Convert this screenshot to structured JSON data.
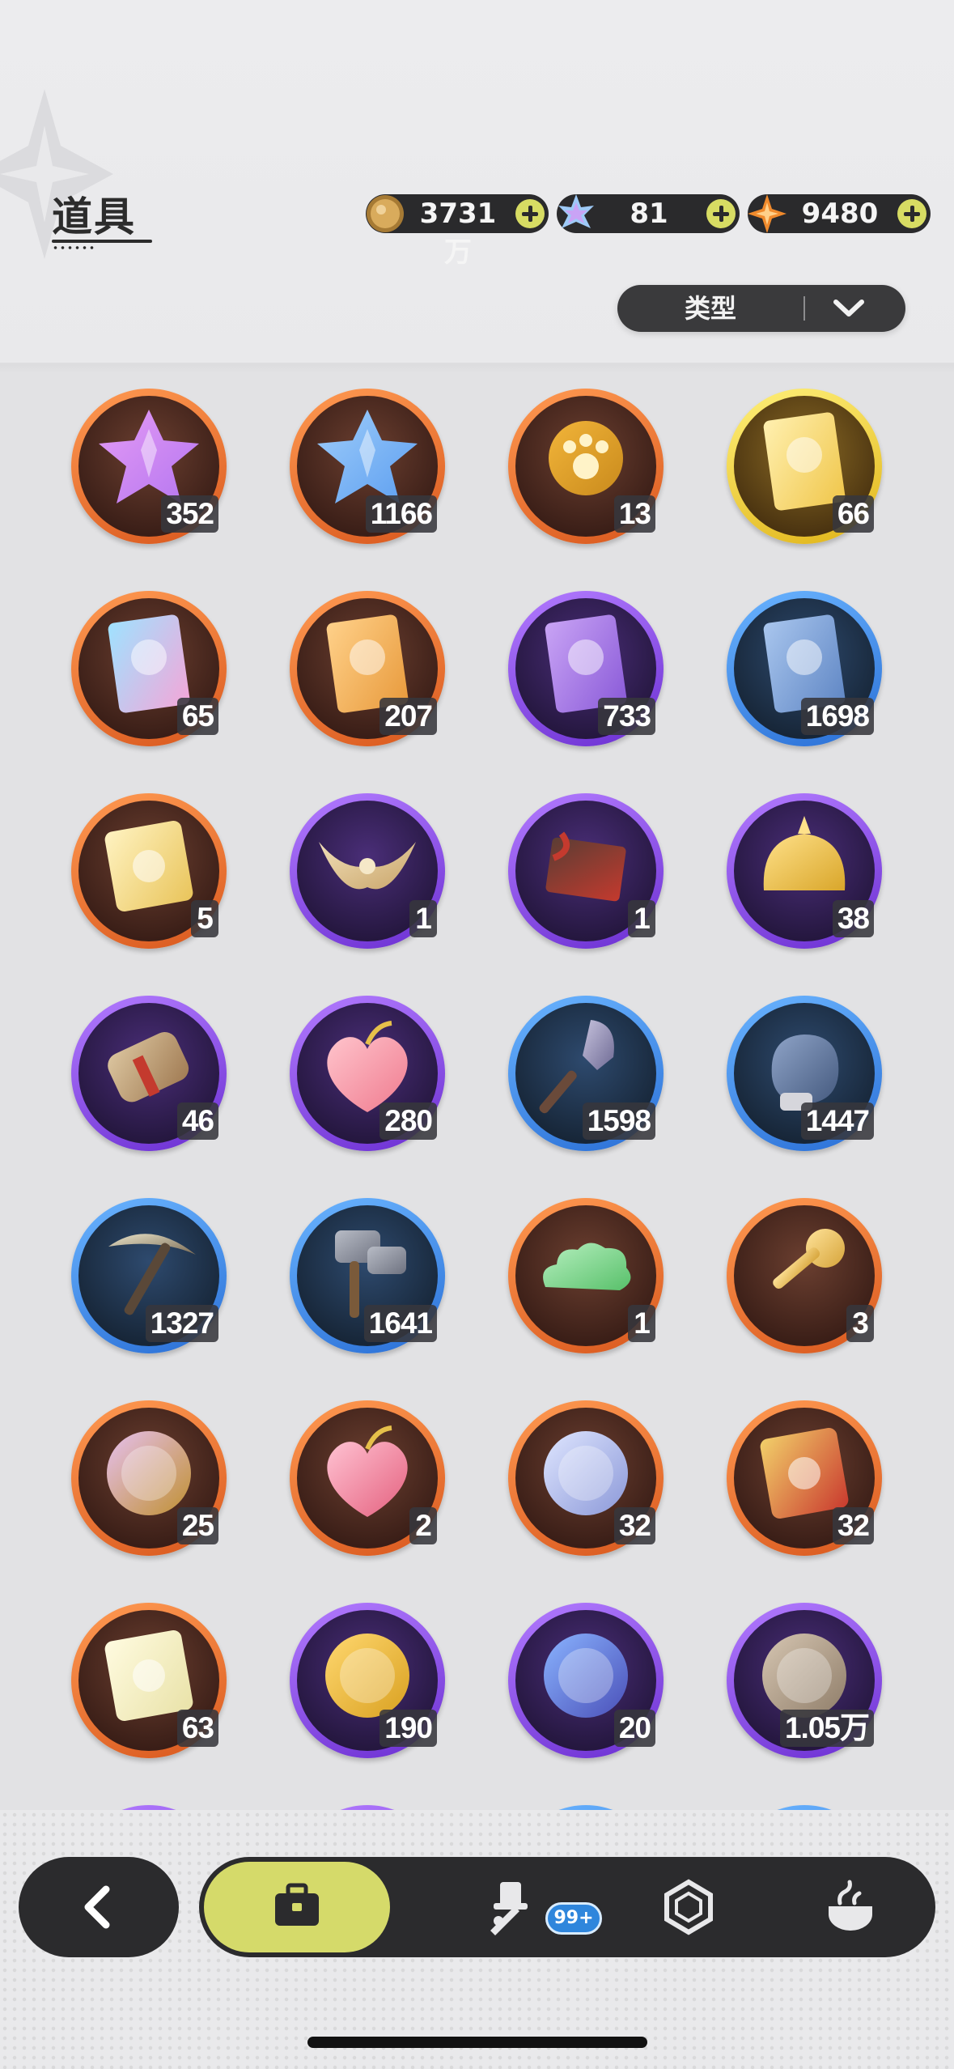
{
  "header": {
    "title": "道具",
    "currencies": [
      {
        "name": "gold-coin",
        "value": "3731万",
        "color": "#c99a4a"
      },
      {
        "name": "crystal",
        "value": "81",
        "color": "#7db9f5"
      },
      {
        "name": "star-gem",
        "value": "9480",
        "color": "#f08a2c"
      }
    ],
    "filter": {
      "label": "类型"
    }
  },
  "grid": {
    "items": [
      {
        "icon": "purple-crystal-icon",
        "rarity": "orange",
        "count": "352"
      },
      {
        "icon": "blue-crystal-icon",
        "rarity": "orange",
        "count": "1166"
      },
      {
        "icon": "paw-compass-icon",
        "rarity": "orange",
        "count": "13"
      },
      {
        "icon": "gold-card-icon",
        "rarity": "gold",
        "count": "66"
      },
      {
        "icon": "rainbow-card-icon",
        "rarity": "orange",
        "count": "65"
      },
      {
        "icon": "orange-card-icon",
        "rarity": "orange",
        "count": "207"
      },
      {
        "icon": "purple-card-icon",
        "rarity": "purple",
        "count": "733"
      },
      {
        "icon": "blue-card-icon",
        "rarity": "blue",
        "count": "1698"
      },
      {
        "icon": "clover-ticket-icon",
        "rarity": "orange",
        "count": "5"
      },
      {
        "icon": "horn-ornament-icon",
        "rarity": "purple",
        "count": "1"
      },
      {
        "icon": "gift-box-icon",
        "rarity": "purple",
        "count": "1"
      },
      {
        "icon": "gold-helmet-icon",
        "rarity": "purple",
        "count": "38"
      },
      {
        "icon": "scroll-icon",
        "rarity": "purple",
        "count": "46"
      },
      {
        "icon": "peach-icon",
        "rarity": "purple",
        "count": "280"
      },
      {
        "icon": "shovel-icon",
        "rarity": "blue",
        "count": "1598"
      },
      {
        "icon": "glove-icon",
        "rarity": "blue",
        "count": "1447"
      },
      {
        "icon": "pickaxe-icon",
        "rarity": "blue",
        "count": "1327"
      },
      {
        "icon": "hammer-icon",
        "rarity": "blue",
        "count": "1641"
      },
      {
        "icon": "cloud-icon",
        "rarity": "orange",
        "count": "1"
      },
      {
        "icon": "key-icon",
        "rarity": "orange",
        "count": "3"
      },
      {
        "icon": "butterfly-emblem-icon",
        "rarity": "orange",
        "count": "25"
      },
      {
        "icon": "heart-gem-icon",
        "rarity": "orange",
        "count": "2"
      },
      {
        "icon": "shirt-token-icon",
        "rarity": "orange",
        "count": "32"
      },
      {
        "icon": "roulette-ticket-icon",
        "rarity": "orange",
        "count": "32"
      },
      {
        "icon": "rainbow-ticket-icon",
        "rarity": "orange",
        "count": "63"
      },
      {
        "icon": "suitcase-coin-icon",
        "rarity": "purple",
        "count": "190"
      },
      {
        "icon": "star-moon-coin-icon",
        "rarity": "purple",
        "count": "20"
      },
      {
        "icon": "fist-coin-icon",
        "rarity": "purple",
        "count": "1.05万"
      }
    ],
    "partial_row_rarity": [
      "purple",
      "purple",
      "blue",
      "blue"
    ]
  },
  "bottom_nav": {
    "back_icon": "back-arrow-icon",
    "tabs": [
      {
        "icon": "toolbox-icon",
        "active": true
      },
      {
        "icon": "sword-hat-icon",
        "active": false
      },
      {
        "icon": "gem-outline-icon",
        "active": false
      },
      {
        "icon": "cooking-pot-icon",
        "active": false
      }
    ],
    "badge": "99+"
  }
}
